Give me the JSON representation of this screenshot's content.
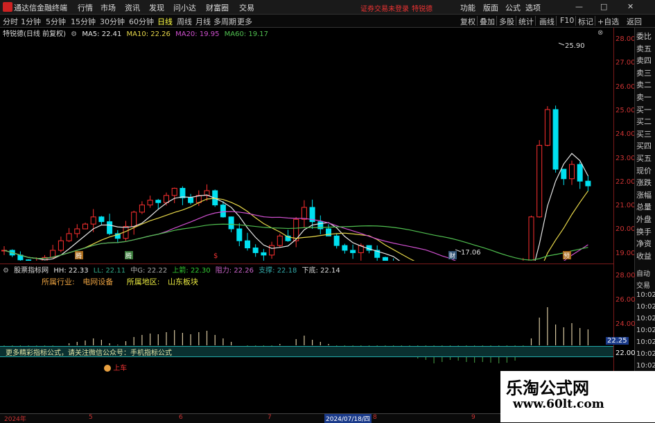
{
  "app": {
    "name": "通达信金融终端",
    "promo": "证券交易未登录",
    "stock_link": "特锐德"
  },
  "menu": [
    "行情",
    "市场",
    "资讯",
    "发现",
    "问小达",
    "财富圈",
    "交易"
  ],
  "right_menu": [
    "功能",
    "版面",
    "公式",
    "选项"
  ],
  "periods": [
    "分时",
    "1分钟",
    "5分钟",
    "15分钟",
    "30分钟",
    "60分钟",
    "日线",
    "周线",
    "月线",
    "多周期",
    "更多"
  ],
  "active_period": "日线",
  "tools": [
    "复权",
    "叠加",
    "多股",
    "统计",
    "画线",
    "F10",
    "标记",
    "+自选",
    "返回"
  ],
  "main_header": {
    "title": "特锐德(日线 前复权)",
    "ma": [
      {
        "label": "MA5: 22.41",
        "color": "#e8e8e8"
      },
      {
        "label": "MA10: 22.26",
        "color": "#e8d84a"
      },
      {
        "label": "MA20: 19.95",
        "color": "#d050d0"
      },
      {
        "label": "MA60: 19.17",
        "color": "#50c050"
      }
    ]
  },
  "annotations": {
    "high": "25.90",
    "low": "17.06",
    "markers": [
      "腾",
      "腾",
      "$",
      "财",
      "预"
    ]
  },
  "sub_header": {
    "title": "股票指标网",
    "items": [
      {
        "label": "HH: 22.33",
        "color": "#e8e8e8"
      },
      {
        "label": "LL: 22.11",
        "color": "#3a8"
      },
      {
        "label": "中G: 22.22",
        "color": "#aaa"
      },
      {
        "label": "上箭: 22.30",
        "color": "#3c3"
      },
      {
        "label": "阻力: 22.26",
        "color": "#c6c"
      },
      {
        "label": "支撑: 22.18",
        "color": "#3aa"
      },
      {
        "label": "下底: 22.14",
        "color": "#ddd"
      }
    ]
  },
  "info": {
    "industry_label": "所属行业:",
    "industry": "电网设备",
    "region_label": "所属地区:",
    "region": "山东板块"
  },
  "banner_text": "更多精彩指标公式，请关注微信公众号：手机指标公式",
  "buy_label": "上车",
  "sub_value": "22.25",
  "side_panel": [
    "委比",
    "卖五",
    "卖四",
    "卖三",
    "卖二",
    "卖一",
    "买一",
    "买二",
    "买三",
    "买四",
    "买五",
    "现价",
    "涨跌",
    "涨幅",
    "总量",
    "外盘",
    "换手",
    "净资",
    "收益"
  ],
  "side_panel2": [
    "自动",
    "交易",
    "10:02",
    "10:02",
    "10:02",
    "10:02",
    "10:02",
    "10:02",
    "10:02",
    "10:02",
    "10:02",
    "10:02"
  ],
  "price_axis": [
    "28.00",
    "27.00",
    "26.00",
    "25.00",
    "24.00",
    "23.00",
    "22.00",
    "21.00",
    "20.00",
    "19.00",
    "18.00",
    "17.00"
  ],
  "sub_axis": [
    "28.00",
    "26.00",
    "24.00",
    "22.00"
  ],
  "date_axis": [
    "2024年",
    "5",
    "6",
    "7",
    "2024/07/18/四",
    "8",
    "9"
  ],
  "watermark": {
    "line1": "乐淘公式网",
    "line2": "www.60lt.com"
  },
  "colors": {
    "up": "#ff3030",
    "down": "#00e0f0",
    "axis": "#c33"
  }
}
